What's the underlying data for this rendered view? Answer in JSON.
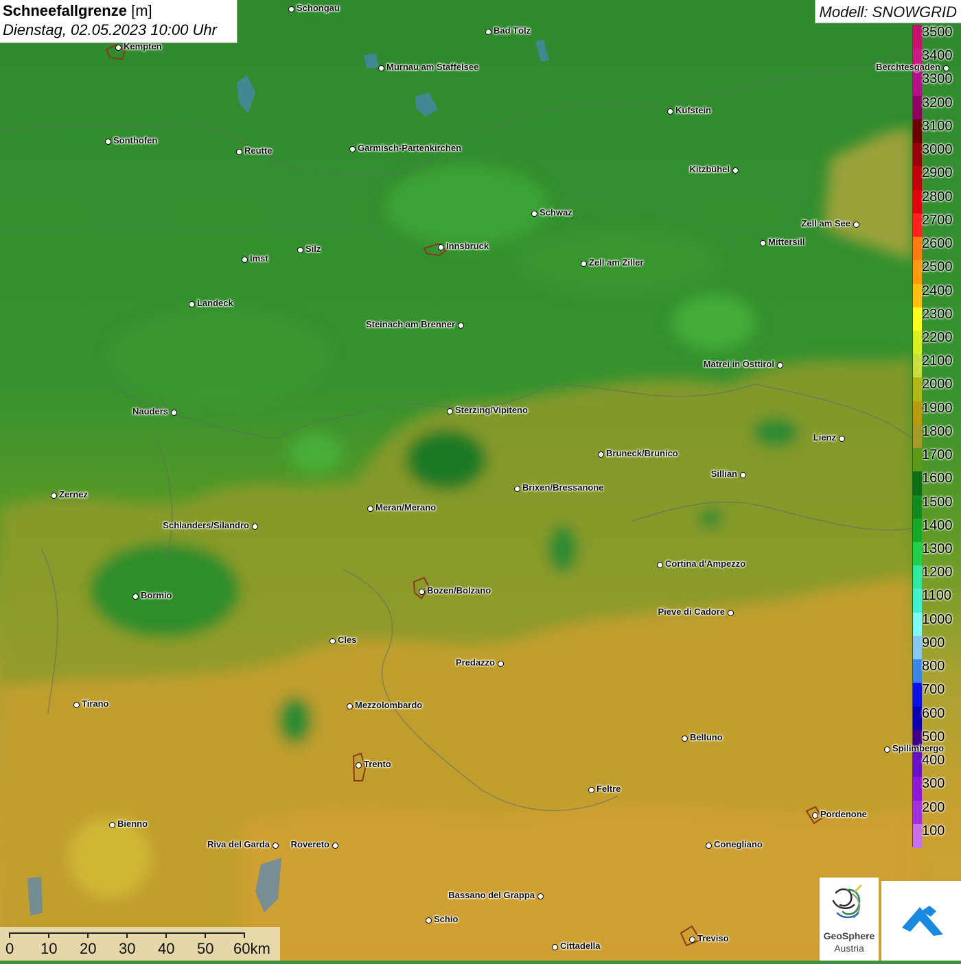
{
  "title": {
    "main": "Schneefallgrenze",
    "unit": "[m]",
    "datetime": "Dienstag, 02.05.2023 10:00 Uhr"
  },
  "model_label": "Modell: SNOWGRID",
  "legend": {
    "labels": [
      "3500",
      "3400",
      "3300",
      "3200",
      "3100",
      "3000",
      "2900",
      "2800",
      "2700",
      "2600",
      "2500",
      "2400",
      "2300",
      "2200",
      "2100",
      "2000",
      "1900",
      "1800",
      "1700",
      "1600",
      "1500",
      "1400",
      "1300",
      "1200",
      "1100",
      "1000",
      "900",
      "800",
      "700",
      "600",
      "500",
      "400",
      "300",
      "200",
      "100"
    ],
    "colors": [
      "#c8106f",
      "#c81a80",
      "#b3108a",
      "#8f0060",
      "#6b0000",
      "#9a0008",
      "#c0000a",
      "#e0000e",
      "#ff2020",
      "#ff7a10",
      "#ff9a10",
      "#ffbe10",
      "#ffff20",
      "#d8f020",
      "#c8e040",
      "#b0b818",
      "#b89a10",
      "#a89a28",
      "#5a9a18",
      "#0e6e18",
      "#128a20",
      "#18a828",
      "#20d04a",
      "#30e8a0",
      "#40f0d0",
      "#80f8f8",
      "#88c8f0",
      "#3a86e8",
      "#0a10e8",
      "#0a00b0",
      "#40008a",
      "#6a10c8",
      "#8e18d8",
      "#a030e0",
      "#c870e8"
    ]
  },
  "cities": [
    {
      "name": "Schongau",
      "side": "r"
    },
    {
      "name": "Bad Tölz",
      "side": "r"
    },
    {
      "name": "Kempten",
      "side": "r"
    },
    {
      "name": "Murnau am Staffelsee",
      "side": "r"
    },
    {
      "name": "Berchtesgaden",
      "side": "l"
    },
    {
      "name": "Kufstein",
      "side": "r"
    },
    {
      "name": "Sonthofen",
      "side": "r"
    },
    {
      "name": "Reutte",
      "side": "r"
    },
    {
      "name": "Garmisch-Partenkirchen",
      "side": "r"
    },
    {
      "name": "Kitzbühel",
      "side": "l"
    },
    {
      "name": "Schwaz",
      "side": "r"
    },
    {
      "name": "Zell am See",
      "side": "l"
    },
    {
      "name": "Mittersill",
      "side": "r"
    },
    {
      "name": "Innsbruck",
      "side": "r"
    },
    {
      "name": "Silz",
      "side": "r"
    },
    {
      "name": "Imst",
      "side": "r"
    },
    {
      "name": "Zell am Ziller",
      "side": "r"
    },
    {
      "name": "Landeck",
      "side": "r"
    },
    {
      "name": "Steinach am Brenner",
      "side": "l"
    },
    {
      "name": "Matrei in Osttirol",
      "side": "l"
    },
    {
      "name": "Nauders",
      "side": "l"
    },
    {
      "name": "Sterzing/Vipiteno",
      "side": "r"
    },
    {
      "name": "Lienz",
      "side": "l"
    },
    {
      "name": "Bruneck/Brunico",
      "side": "r"
    },
    {
      "name": "Sillian",
      "side": "l"
    },
    {
      "name": "Zernez",
      "side": "r"
    },
    {
      "name": "Brixen/Bressanone",
      "side": "r"
    },
    {
      "name": "Meran/Merano",
      "side": "r"
    },
    {
      "name": "Schlanders/Silandro",
      "side": "l"
    },
    {
      "name": "Cortina d'Ampezzo",
      "side": "r"
    },
    {
      "name": "Bozen/Bolzano",
      "side": "r"
    },
    {
      "name": "Bormio",
      "side": "r"
    },
    {
      "name": "Pieve di Cadore",
      "side": "l"
    },
    {
      "name": "Cles",
      "side": "r"
    },
    {
      "name": "Predazzo",
      "side": "l"
    },
    {
      "name": "Tirano",
      "side": "r"
    },
    {
      "name": "Mezzolombardo",
      "side": "r"
    },
    {
      "name": "Belluno",
      "side": "r"
    },
    {
      "name": "Spilimbergo",
      "side": "r"
    },
    {
      "name": "Trento",
      "side": "r"
    },
    {
      "name": "Feltre",
      "side": "r"
    },
    {
      "name": "Pordenone",
      "side": "r"
    },
    {
      "name": "Bienno",
      "side": "r"
    },
    {
      "name": "Riva del Garda",
      "side": "l"
    },
    {
      "name": "Rovereto",
      "side": "l"
    },
    {
      "name": "Conegliano",
      "side": "r"
    },
    {
      "name": "Bassano del Grappa",
      "side": "l"
    },
    {
      "name": "Schio",
      "side": "r"
    },
    {
      "name": "Treviso",
      "side": "r"
    },
    {
      "name": "Cittadella",
      "side": "r"
    }
  ],
  "scale_bar": {
    "labels": [
      "0",
      "10",
      "20",
      "30",
      "40",
      "50",
      "60km"
    ]
  },
  "logos": {
    "geosphere_line1": "GeoSphere",
    "geosphere_line2": "Austria"
  }
}
